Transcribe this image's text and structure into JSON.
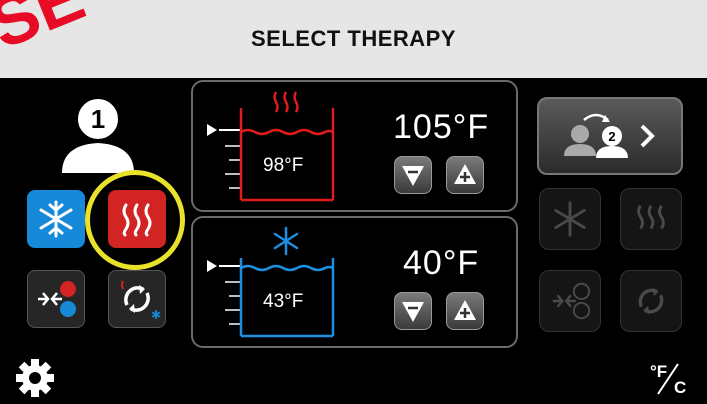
{
  "header": {
    "title": "SELECT THERAPY"
  },
  "watermark": "SE",
  "user": {
    "number": "1"
  },
  "modes": [
    {
      "name": "cold",
      "icon": "snowflake-icon",
      "color": "#1689d8"
    },
    {
      "name": "heat",
      "icon": "heat-waves-icon",
      "color": "#d32424",
      "selected": true
    },
    {
      "name": "contrast",
      "icon": "contrast-icon"
    },
    {
      "name": "cycle",
      "icon": "cycle-icon"
    }
  ],
  "heat_panel": {
    "tank_temp": "98°F",
    "set_temp": "105°F",
    "color": "#e01b1b"
  },
  "cold_panel": {
    "tank_temp": "43°F",
    "set_temp": "40°F",
    "color": "#1e8fe0"
  },
  "switch_user": {
    "number": "2"
  },
  "units_label": {
    "top": "°F",
    "bottom": "C"
  },
  "colors": {
    "highlight": "#e9e22a",
    "header_bg": "#e6e6e6"
  }
}
